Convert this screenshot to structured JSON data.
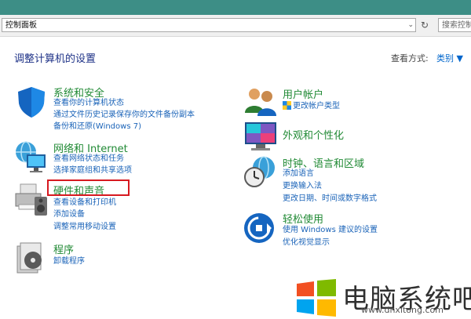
{
  "address_bar": {
    "path": "控制面板",
    "search_placeholder": "搜索控制"
  },
  "heading": "调整计算机的设置",
  "view_by": {
    "label": "查看方式:",
    "value": "类别 ▼"
  },
  "categories": [
    {
      "title": "系统和安全",
      "links": [
        "查看你的计算机状态",
        "通过文件历史记录保存你的文件备份副本",
        "备份和还原(Windows 7)"
      ]
    },
    {
      "title": "网络和 Internet",
      "links": [
        "查看网络状态和任务",
        "选择家庭组和共享选项"
      ]
    },
    {
      "title": "硬件和声音",
      "links": [
        "查看设备和打印机",
        "添加设备",
        "调整常用移动设置"
      ]
    },
    {
      "title": "程序",
      "links": [
        "卸载程序"
      ]
    },
    {
      "title": "用户帐户",
      "links": [
        "更改帐户类型"
      ]
    },
    {
      "title": "外观和个性化",
      "links": []
    },
    {
      "title": "时钟、语言和区域",
      "links": [
        "添加语言",
        "更换输入法",
        "更改日期、时间或数字格式"
      ]
    },
    {
      "title": "轻松使用",
      "links": [
        "使用 Windows 建议的设置",
        "优化视觉显示"
      ]
    }
  ],
  "watermark": {
    "brand": "电脑系统吧",
    "site": "www.dnxitong.com"
  },
  "colors": {
    "title_green": "#218a35",
    "link_blue": "#1a63b8",
    "heading_blue": "#1e3287",
    "highlight_red": "#d71920"
  }
}
